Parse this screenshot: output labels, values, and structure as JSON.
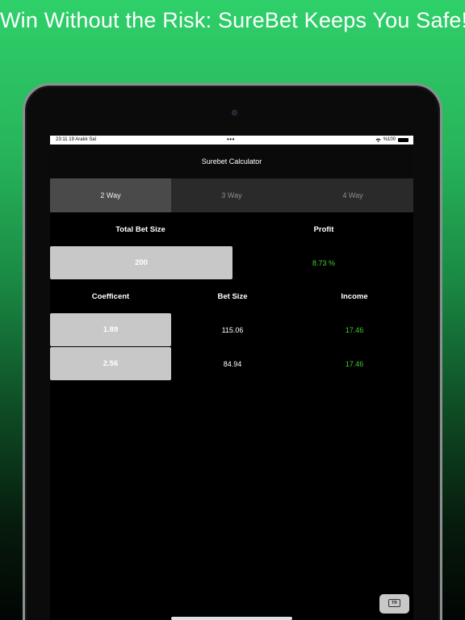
{
  "headline": "Win Without the Risk: SureBet Keeps You Safe!",
  "status_bar": {
    "time": "23:11  19 Aralık Sal",
    "dots": "•••",
    "battery": "%100"
  },
  "nav": {
    "title": "Surebet Calculator"
  },
  "tabs": [
    {
      "label": "2 Way",
      "active": true
    },
    {
      "label": "3 Way",
      "active": false
    },
    {
      "label": "4 Way",
      "active": false
    }
  ],
  "summary": {
    "total_bet_label": "Total Bet Size",
    "total_bet_value": "200",
    "profit_label": "Profit",
    "profit_value": "8.73 %"
  },
  "table": {
    "headers": [
      "Coefficent",
      "Bet Size",
      "Income"
    ],
    "rows": [
      {
        "coefficient": "1.89",
        "bet_size": "115.06",
        "income": "17.46"
      },
      {
        "coefficient": "2.56",
        "bet_size": "84.94",
        "income": "17.46"
      }
    ]
  },
  "keyboard_key": "TR",
  "colors": {
    "accent_green": "#3fd12c",
    "input_bg": "#c8c8c8",
    "active_tab": "#4a4a4a"
  }
}
